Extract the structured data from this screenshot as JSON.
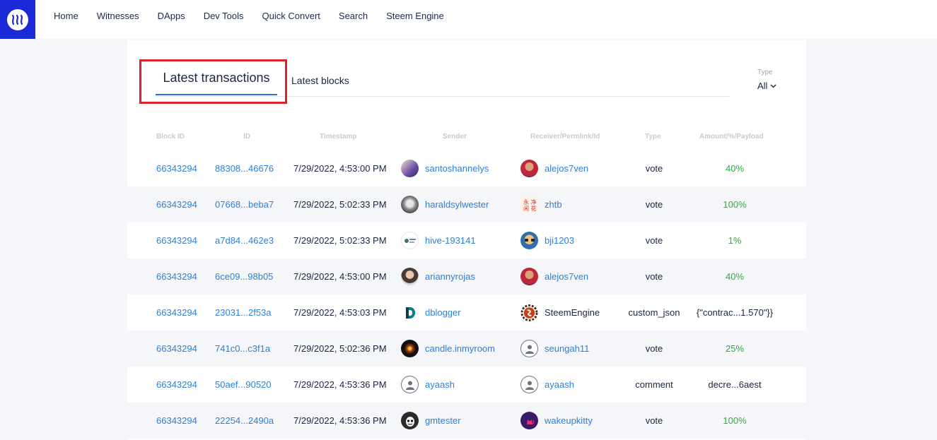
{
  "nav": {
    "items": [
      "Home",
      "Witnesses",
      "DApps",
      "Dev Tools",
      "Quick Convert",
      "Search",
      "Steem Engine"
    ]
  },
  "tabs": {
    "active": "Latest transactions",
    "other": "Latest blocks"
  },
  "type_filter": {
    "label": "Type",
    "value": "All"
  },
  "table": {
    "headers": [
      "Block ID",
      "ID",
      "Timestamp",
      "Sender",
      "Receiver/Permlink/Id",
      "Type",
      "Amount/%/Payload"
    ],
    "rows": [
      {
        "block": "66343294",
        "id": "88308...46676",
        "ts": "7/29/2022, 4:53:00 PM",
        "sender": "santoshannelys",
        "receiver": "alejos7ven",
        "type": "vote",
        "amount": "40%"
      },
      {
        "block": "66343294",
        "id": "07668...beba7",
        "ts": "7/29/2022, 5:02:33 PM",
        "sender": "haraldsylwester",
        "receiver": "zhtb",
        "type": "vote",
        "amount": "100%"
      },
      {
        "block": "66343294",
        "id": "a7d84...462e3",
        "ts": "7/29/2022, 5:02:33 PM",
        "sender": "hive-193141",
        "receiver": "bji1203",
        "type": "vote",
        "amount": "1%"
      },
      {
        "block": "66343294",
        "id": "6ce09...98b05",
        "ts": "7/29/2022, 4:53:00 PM",
        "sender": "ariannyrojas",
        "receiver": "alejos7ven",
        "type": "vote",
        "amount": "40%"
      },
      {
        "block": "66343294",
        "id": "23031...2f53a",
        "ts": "7/29/2022, 4:53:03 PM",
        "sender": "dblogger",
        "receiver": "SteemEngine",
        "type": "custom_json",
        "amount": "{\"contrac...1.570\"}}"
      },
      {
        "block": "66343294",
        "id": "741c0...c3f1a",
        "ts": "7/29/2022, 5:02:36 PM",
        "sender": "candle.inmyroom",
        "receiver": "seungah11",
        "type": "vote",
        "amount": "25%"
      },
      {
        "block": "66343294",
        "id": "50aef...90520",
        "ts": "7/29/2022, 4:53:36 PM",
        "sender": "ayaash",
        "receiver": "ayaash",
        "type": "comment",
        "amount": "decre...6aest"
      },
      {
        "block": "66343294",
        "id": "22254...2490a",
        "ts": "7/29/2022, 4:53:36 PM",
        "sender": "gmtester",
        "receiver": "wakeupkitty",
        "type": "vote",
        "amount": "100%"
      }
    ]
  },
  "colors": {
    "brand": "#1a2ad6",
    "link": "#2f7fd6",
    "percent": "#3aa542",
    "highlight": "#d9222a"
  }
}
